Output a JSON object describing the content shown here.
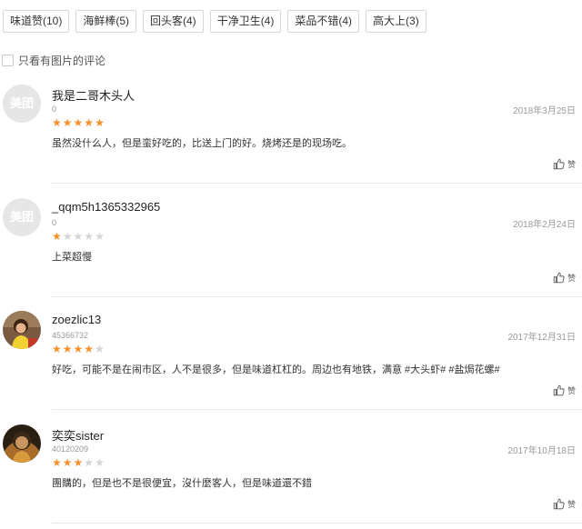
{
  "tags": [
    {
      "label": "味道赞(10)"
    },
    {
      "label": "海鲜棒(5)"
    },
    {
      "label": "回头客(4)"
    },
    {
      "label": "干净卫生(4)"
    },
    {
      "label": "菜品不错(4)"
    },
    {
      "label": "高大上(3)"
    }
  ],
  "filter": {
    "label": "只看有图片的评论"
  },
  "placeholder_avatar_text": "美团",
  "like_label": "赞",
  "colors": {
    "star_on": "#f9902a",
    "star_off": "#d5d5d5",
    "border": "#d9d9d9"
  },
  "reviews": [
    {
      "username": "我是二哥木头人",
      "user_id": "0",
      "date": "2018年3月25日",
      "rating": 5,
      "content": "虽然没什么人，但是蛮好吃的，比送上门的好。烧烤还是的现场吃。"
    },
    {
      "username": "_qqm5h1365332965",
      "user_id": "0",
      "date": "2018年2月24日",
      "rating": 1,
      "content": "上菜超慢"
    },
    {
      "username": "zoezlic13",
      "user_id": "45366732",
      "date": "2017年12月31日",
      "rating": 4,
      "content": "好吃，可能不是在闹市区，人不是很多，但是味道杠杠的。周边也有地铁，满意 #大头虾# #盐焗花螺#"
    },
    {
      "username": "奕奕sister",
      "user_id": "40120209",
      "date": "2017年10月18日",
      "rating": 3,
      "content": "團購的，但是也不是很便宜，沒什麼客人，但是味道還不錯"
    }
  ]
}
